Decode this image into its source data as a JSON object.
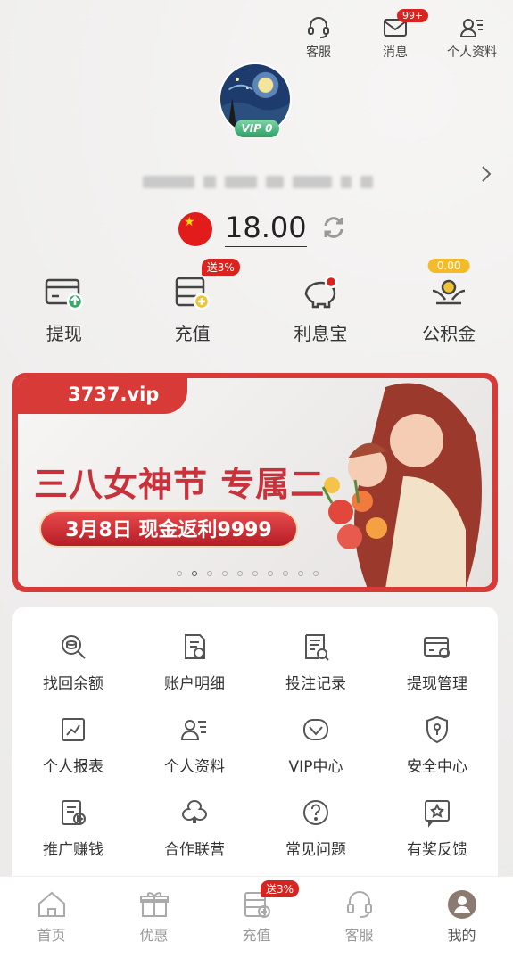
{
  "top_actions": [
    {
      "label": "客服",
      "icon": "headset-icon"
    },
    {
      "label": "消息",
      "icon": "mail-icon",
      "badge": "99+"
    },
    {
      "label": "个人资料",
      "icon": "profile-card-icon"
    }
  ],
  "profile": {
    "vip_level": "VIP 0",
    "balance": "18.00",
    "currency_flag": "cn-flag-icon"
  },
  "quick_actions": [
    {
      "label": "提现",
      "icon": "withdraw-icon"
    },
    {
      "label": "充值",
      "icon": "deposit-icon",
      "badge": "送3%"
    },
    {
      "label": "利息宝",
      "icon": "piggy-bank-icon"
    },
    {
      "label": "公积金",
      "icon": "fund-icon",
      "badge": "0.00"
    }
  ],
  "banner": {
    "tag": "3737.vip",
    "title": "三八女神节 专属二",
    "subtitle": "3月8日 现金返利9999",
    "page_count": 10,
    "active_index": 1
  },
  "menu": [
    {
      "label": "找回余额",
      "icon": "search-coin-icon"
    },
    {
      "label": "账户明细",
      "icon": "account-detail-icon"
    },
    {
      "label": "投注记录",
      "icon": "bet-record-icon"
    },
    {
      "label": "提现管理",
      "icon": "withdraw-manage-icon"
    },
    {
      "label": "个人报表",
      "icon": "report-icon"
    },
    {
      "label": "个人资料",
      "icon": "profile-card-icon"
    },
    {
      "label": "VIP中心",
      "icon": "vip-diamond-icon"
    },
    {
      "label": "安全中心",
      "icon": "shield-icon"
    },
    {
      "label": "推广赚钱",
      "icon": "promote-icon"
    },
    {
      "label": "合作联营",
      "icon": "club-icon"
    },
    {
      "label": "常见问题",
      "icon": "question-icon"
    },
    {
      "label": "有奖反馈",
      "icon": "feedback-star-icon"
    }
  ],
  "bottom_nav": [
    {
      "label": "首页",
      "icon": "home-icon"
    },
    {
      "label": "优惠",
      "icon": "gift-icon"
    },
    {
      "label": "充值",
      "icon": "deposit-icon",
      "badge": "送3%"
    },
    {
      "label": "客服",
      "icon": "headset-icon"
    },
    {
      "label": "我的",
      "icon": "user-icon",
      "active": true
    }
  ],
  "colors": {
    "accent_red": "#d8231f",
    "banner_red": "#d83a38",
    "icon_gray": "#555555",
    "gold": "#f3bb2a",
    "green": "#2e9e65"
  }
}
